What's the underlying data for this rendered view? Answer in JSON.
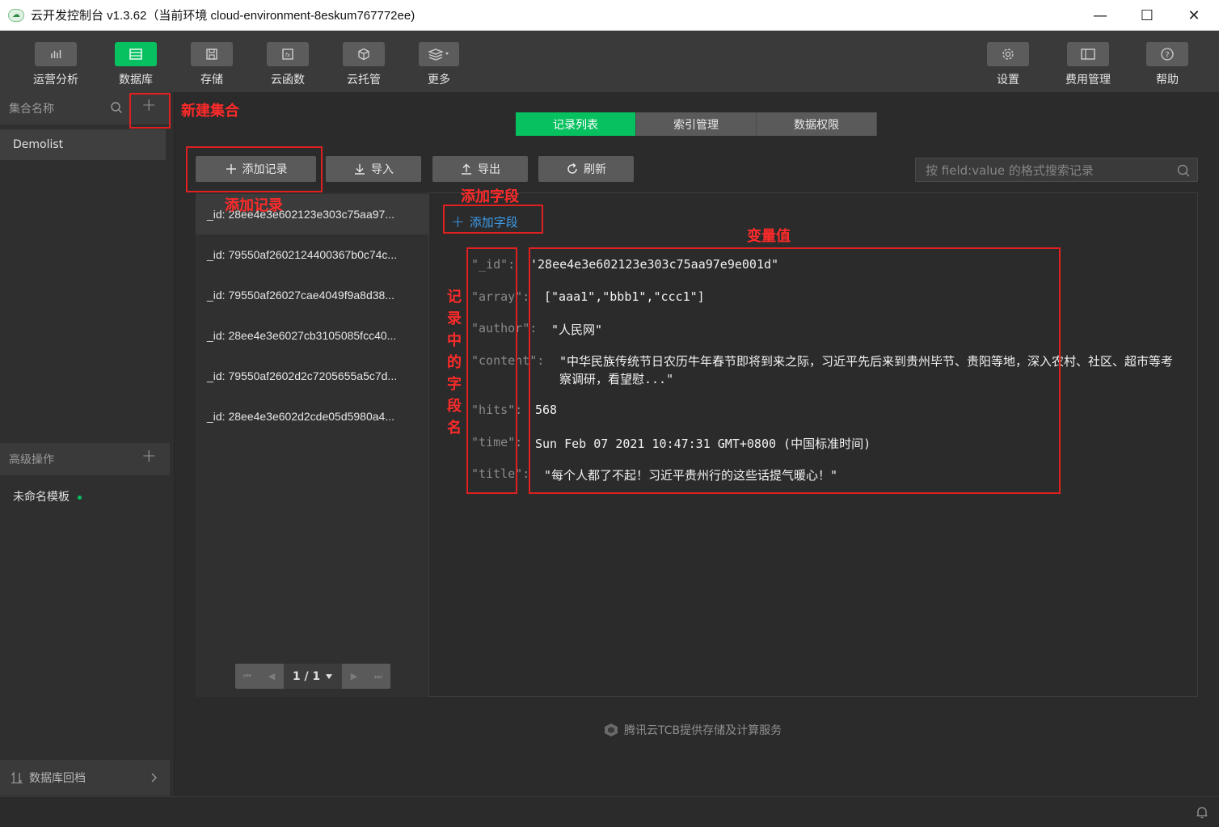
{
  "window": {
    "title": "云开发控制台 v1.3.62（当前环境 cloud-environment-8eskum767772ee)",
    "minimize": "—",
    "maximize": "☐",
    "close": "✕"
  },
  "toolbar": {
    "left": [
      {
        "label": "运营分析",
        "icon": "chart-icon"
      },
      {
        "label": "数据库",
        "icon": "database-icon",
        "active": true
      },
      {
        "label": "存储",
        "icon": "save-icon"
      },
      {
        "label": "云函数",
        "icon": "function-icon"
      },
      {
        "label": "云托管",
        "icon": "cube-icon"
      },
      {
        "label": "更多",
        "icon": "layers-icon"
      }
    ],
    "right": [
      {
        "label": "设置",
        "icon": "gear-icon"
      },
      {
        "label": "费用管理",
        "icon": "billing-icon"
      },
      {
        "label": "帮助",
        "icon": "help-icon"
      }
    ]
  },
  "sidebar": {
    "collections_header": "集合名称",
    "collections": [
      "Demolist"
    ],
    "advanced_header": "高级操作",
    "templates": [
      "未命名模板"
    ],
    "rollback": "数据库回档"
  },
  "tabs": [
    "记录列表",
    "索引管理",
    "数据权限"
  ],
  "actions": {
    "add_record": "添加记录",
    "import": "导入",
    "export": "导出",
    "refresh": "刷新"
  },
  "search": {
    "placeholder": "按 field:value 的格式搜索记录"
  },
  "records": [
    "_id: 28ee4e3e602123e303c75aa97...",
    "_id: 79550af2602124400367b0c74c...",
    "_id: 79550af26027cae4049f9a8d38...",
    "_id: 28ee4e3e6027cb3105085fcc40...",
    "_id: 79550af2602d2c7205655a5c7d...",
    "_id: 28ee4e3e602d2cde05d5980a4..."
  ],
  "pager": {
    "text": "1 / 1"
  },
  "add_field": "添加字段",
  "fields": [
    {
      "name": "\"_id\":",
      "value": "'28ee4e3e602123e303c75aa97e9e001d\""
    },
    {
      "name": "\"array\":",
      "value": "[\"aaa1\",\"bbb1\",\"ccc1\"]"
    },
    {
      "name": "\"author\":",
      "value": "\"人民网\""
    },
    {
      "name": "\"content\":",
      "value": "\"中华民族传统节日农历牛年春节即将到来之际，习近平先后来到贵州毕节、贵阳等地，深入农村、社区、超市等考察调研，看望慰...\""
    },
    {
      "name": "\"hits\":",
      "value": "568"
    },
    {
      "name": "\"time\":",
      "value": "Sun Feb 07 2021 10:47:31 GMT+0800 (中国标准时间)"
    },
    {
      "name": "\"title\":",
      "value": "\"每个人都了不起！习近平贵州行的这些话提气暖心！\""
    }
  ],
  "annotations": {
    "new_collection": "新建集合",
    "add_record": "添加记录",
    "add_field": "添加字段",
    "values": "变量值",
    "field_names": "记录中的字段名"
  },
  "footer": {
    "powered_by": "腾讯云TCB提供存储及计算服务"
  },
  "colors": {
    "accent": "#07c160",
    "annotation": "#e02020",
    "link": "#3d9be9"
  }
}
